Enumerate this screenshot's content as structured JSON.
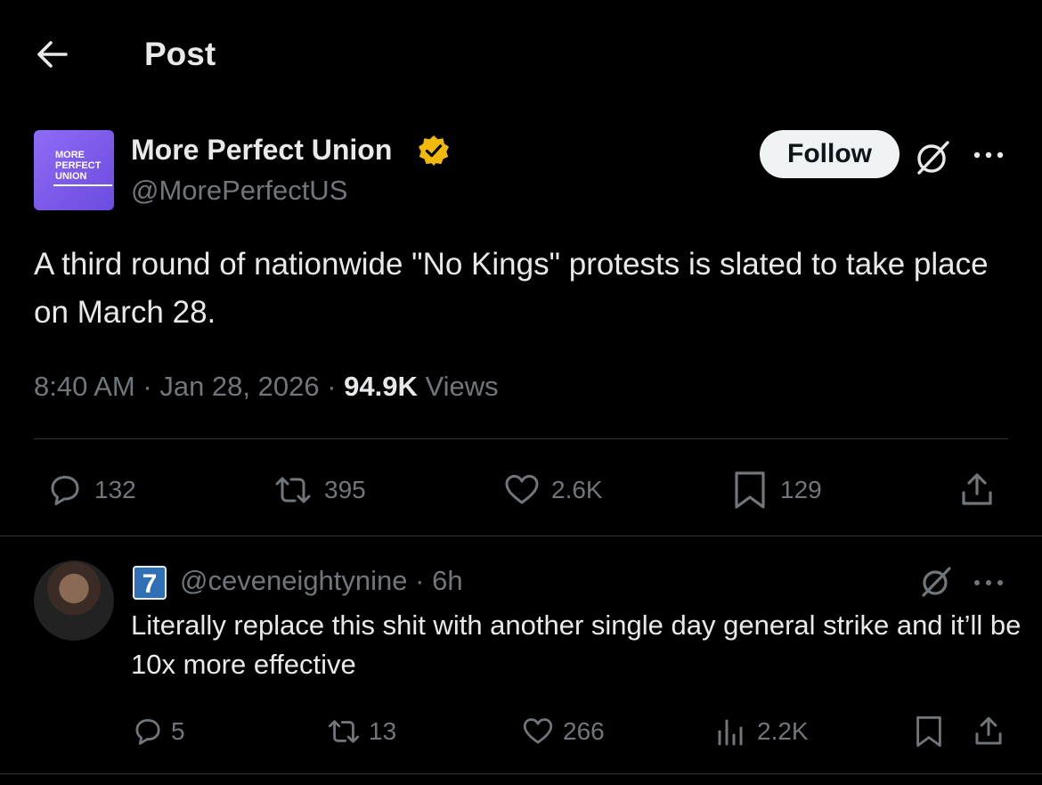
{
  "header": {
    "title": "Post",
    "back_icon": "arrow-left-icon"
  },
  "post": {
    "author": {
      "name": "More Perfect Union",
      "handle": "@MorePerfectUS",
      "avatar_text": "MORE PERFECT UNION",
      "verified": true
    },
    "follow_label": "Follow",
    "text": "A third round of nationwide \"No Kings\" protests is slated to take place on March 28.",
    "time": "8:40 AM",
    "date": "Jan 28, 2026",
    "views_count": "94.9K",
    "views_label": "Views",
    "separator": "·",
    "stats": {
      "replies": "132",
      "reposts": "395",
      "likes": "2.6K",
      "bookmarks": "129"
    }
  },
  "reply": {
    "badge": "7",
    "handle": "@ceveneightynine",
    "age": "6h",
    "text": "Literally replace this shit with another single day general strike and it’ll be 10x more effective",
    "stats": {
      "replies": "5",
      "reposts": "13",
      "likes": "266",
      "views": "2.2K"
    }
  },
  "colors": {
    "background": "#000000",
    "text": "#e7e9ea",
    "muted": "#71767b",
    "divider": "#2f3336",
    "verified_badge": "#f0b90b",
    "follow_button_bg": "#eff3f4",
    "avatar_bg": "#7c5cf0"
  }
}
